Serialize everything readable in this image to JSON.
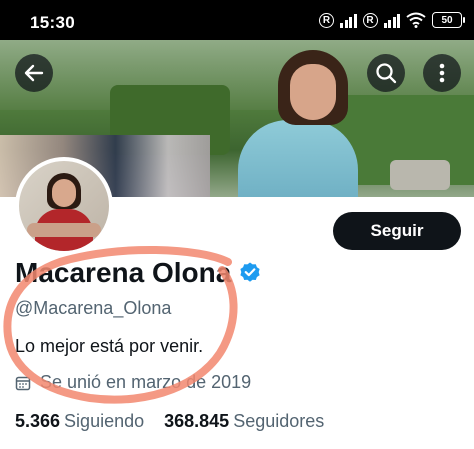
{
  "status_bar": {
    "time": "15:30",
    "r_badge": "R",
    "battery": "50",
    "icons": [
      "signal-icon",
      "wifi-icon",
      "battery-icon"
    ]
  },
  "header": {
    "back_icon": "arrow-left-icon",
    "search_icon": "search-icon",
    "more_icon": "more-vertical-icon"
  },
  "profile": {
    "follow_label": "Seguir",
    "display_name": "Macarena Olona",
    "verified_icon": "verified-badge-icon",
    "handle": "@Macarena_Olona",
    "bio": "Lo mejor está por venir.",
    "joined": "Se unió en marzo de 2019",
    "following_count": "5.366",
    "following_label": "Siguiendo",
    "followers_count": "368.845",
    "followers_label": "Seguidores"
  },
  "colors": {
    "verified": "#1d9bf0",
    "annotation": "#f2876f",
    "text_primary": "#0f1419",
    "text_secondary": "#536471"
  }
}
